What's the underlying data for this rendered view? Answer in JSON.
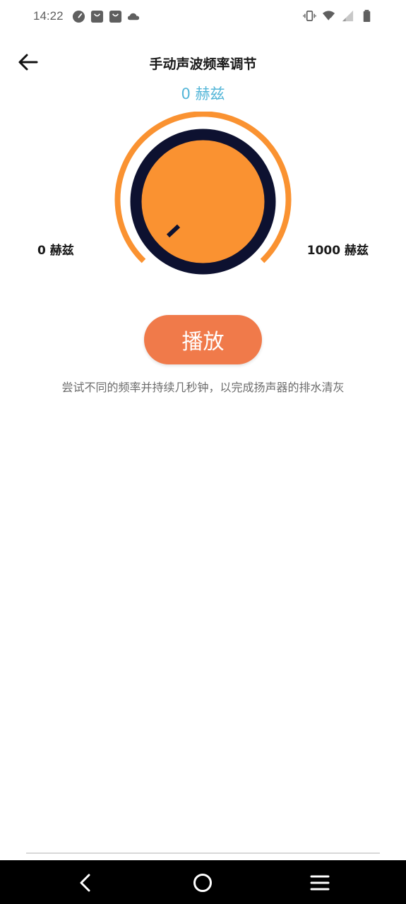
{
  "status_bar": {
    "time": "14:22",
    "left_icons": [
      "speedometer-icon",
      "shopping-bag-icon",
      "shopping-bag-icon",
      "cloud-icon"
    ],
    "right_icons": [
      "vibrate-icon",
      "wifi-icon",
      "signal-icon",
      "battery-icon"
    ]
  },
  "header": {
    "title": "手动声波频率调节",
    "back_icon": "arrow-left-icon"
  },
  "frequency": {
    "current_label": "0 赫兹",
    "current_value": 0,
    "min_label": "0 赫兹",
    "max_label": "1000 赫兹",
    "min_value": 0,
    "max_value": 1000
  },
  "actions": {
    "play_label": "播放"
  },
  "hint": "尝试不同的频率并持续几秒钟，以完成扬声器的排水清灰",
  "colors": {
    "accent_orange": "#fa9231",
    "knob_ring": "#0d1130",
    "play_button": "#f07a4a",
    "frequency_text": "#54b6d8"
  },
  "nav_bar": {
    "icons": [
      "back-nav-icon",
      "home-nav-icon",
      "menu-nav-icon"
    ]
  }
}
